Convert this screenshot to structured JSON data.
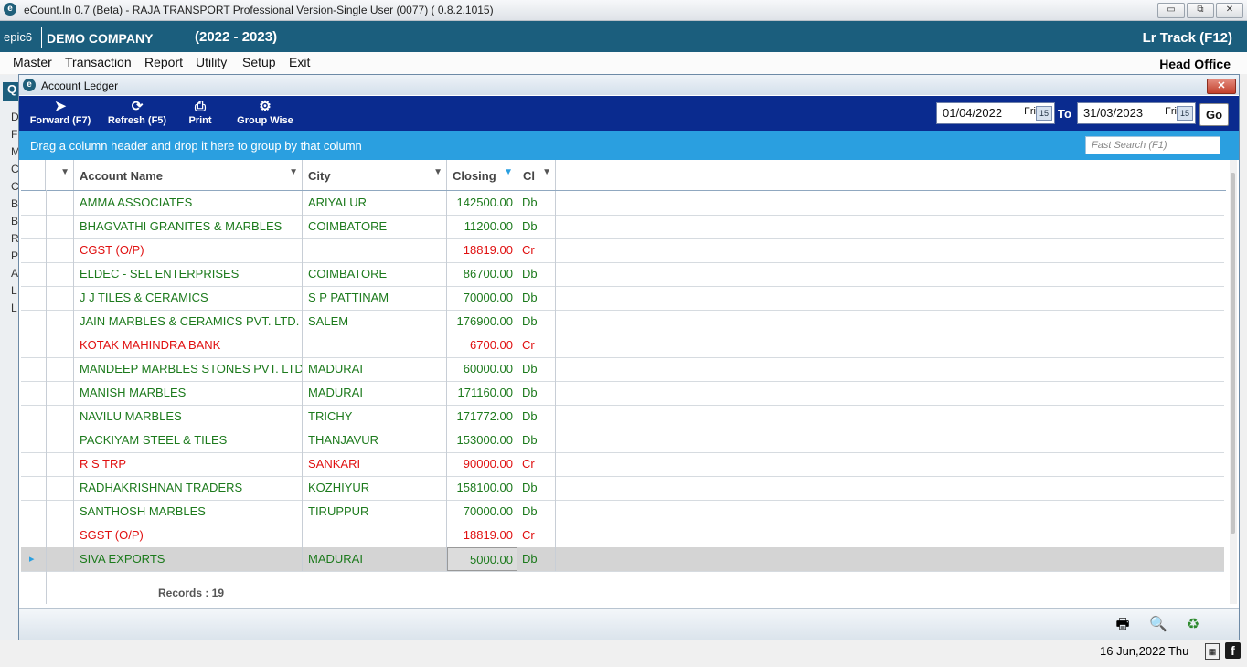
{
  "app": {
    "title": "eCount.In 0.7 (Beta) - RAJA TRANSPORT Professional Version-Single User (0077) ( 0.8.2.1015)",
    "logo_letter": "e",
    "window_buttons": [
      "▭",
      "⧉",
      "✕"
    ]
  },
  "header": {
    "user": "epic6",
    "company": "DEMO COMPANY",
    "year": "(2022 - 2023)",
    "lr_track": "Lr Track (F12)"
  },
  "menu": {
    "items": [
      "Master",
      "Transaction",
      "Report",
      "Utility",
      "Setup",
      "Exit"
    ],
    "office": "Head Office"
  },
  "left_panel": {
    "tab_label": "Q",
    "letters": [
      "D",
      "F",
      "M",
      "C",
      "C",
      "B",
      "B",
      "R",
      "P",
      "A",
      "L",
      "L"
    ]
  },
  "ledger": {
    "title": "Account Ledger",
    "close": "✕",
    "toolbar": {
      "forward": "Forward (F7)",
      "refresh": "Refresh (F5)",
      "print": "Print",
      "group_wise": "Group Wise"
    },
    "from_date": "01/04/2022",
    "from_day": "Fri",
    "to_label": "To",
    "to_date": "31/03/2023",
    "to_day": "Fri",
    "cal_label": "15",
    "go": "Go",
    "group_hint": "Drag a column header and drop it here to group by that column",
    "fast_search": "Fast Search (F1)",
    "columns": [
      "Account Name",
      "City",
      "Closing",
      "Cl"
    ],
    "rows": [
      {
        "name": "AMMA ASSOCIATES",
        "city": "ARIYALUR",
        "closing": "142500.00",
        "cl": "Db",
        "color": "green"
      },
      {
        "name": "BHAGVATHI GRANITES & MARBLES",
        "city": "COIMBATORE",
        "closing": "11200.00",
        "cl": "Db",
        "color": "green"
      },
      {
        "name": "CGST (O/P)",
        "city": "",
        "closing": "18819.00",
        "cl": "Cr",
        "color": "red"
      },
      {
        "name": "ELDEC - SEL ENTERPRISES",
        "city": "COIMBATORE",
        "closing": "86700.00",
        "cl": "Db",
        "color": "green"
      },
      {
        "name": "J J TILES & CERAMICS",
        "city": "S P PATTINAM",
        "closing": "70000.00",
        "cl": "Db",
        "color": "green"
      },
      {
        "name": "JAIN MARBLES & CERAMICS PVT. LTD.",
        "city": "SALEM",
        "closing": "176900.00",
        "cl": "Db",
        "color": "green"
      },
      {
        "name": "KOTAK MAHINDRA BANK",
        "city": "",
        "closing": "6700.00",
        "cl": "Cr",
        "color": "red"
      },
      {
        "name": "MANDEEP MARBLES STONES PVT. LTD.",
        "city": "MADURAI",
        "closing": "60000.00",
        "cl": "Db",
        "color": "green"
      },
      {
        "name": "MANISH MARBLES",
        "city": "MADURAI",
        "closing": "171160.00",
        "cl": "Db",
        "color": "green"
      },
      {
        "name": "NAVILU MARBLES",
        "city": "TRICHY",
        "closing": "171772.00",
        "cl": "Db",
        "color": "green"
      },
      {
        "name": "PACKIYAM STEEL & TILES",
        "city": "THANJAVUR",
        "closing": "153000.00",
        "cl": "Db",
        "color": "green"
      },
      {
        "name": "R S TRP",
        "city": "SANKARI",
        "closing": "90000.00",
        "cl": "Cr",
        "color": "red"
      },
      {
        "name": "RADHAKRISHNAN TRADERS",
        "city": "KOZHIYUR",
        "closing": "158100.00",
        "cl": "Db",
        "color": "green"
      },
      {
        "name": "SANTHOSH MARBLES",
        "city": "TIRUPPUR",
        "closing": "70000.00",
        "cl": "Db",
        "color": "green"
      },
      {
        "name": "SGST (O/P)",
        "city": "",
        "closing": "18819.00",
        "cl": "Cr",
        "color": "red"
      },
      {
        "name": "SIVA EXPORTS",
        "city": "MADURAI",
        "closing": "5000.00",
        "cl": "Db",
        "color": "green",
        "selected": true
      }
    ],
    "records": "Records : 19"
  },
  "status": {
    "date": "16 Jun,2022 Thu",
    "fb": "f"
  },
  "colors": {
    "header": "#1b5e7d",
    "toolbar": "#0a2b8f",
    "groupbar": "#2a9fe0",
    "green": "#1c7a1c",
    "red": "#e01010"
  }
}
